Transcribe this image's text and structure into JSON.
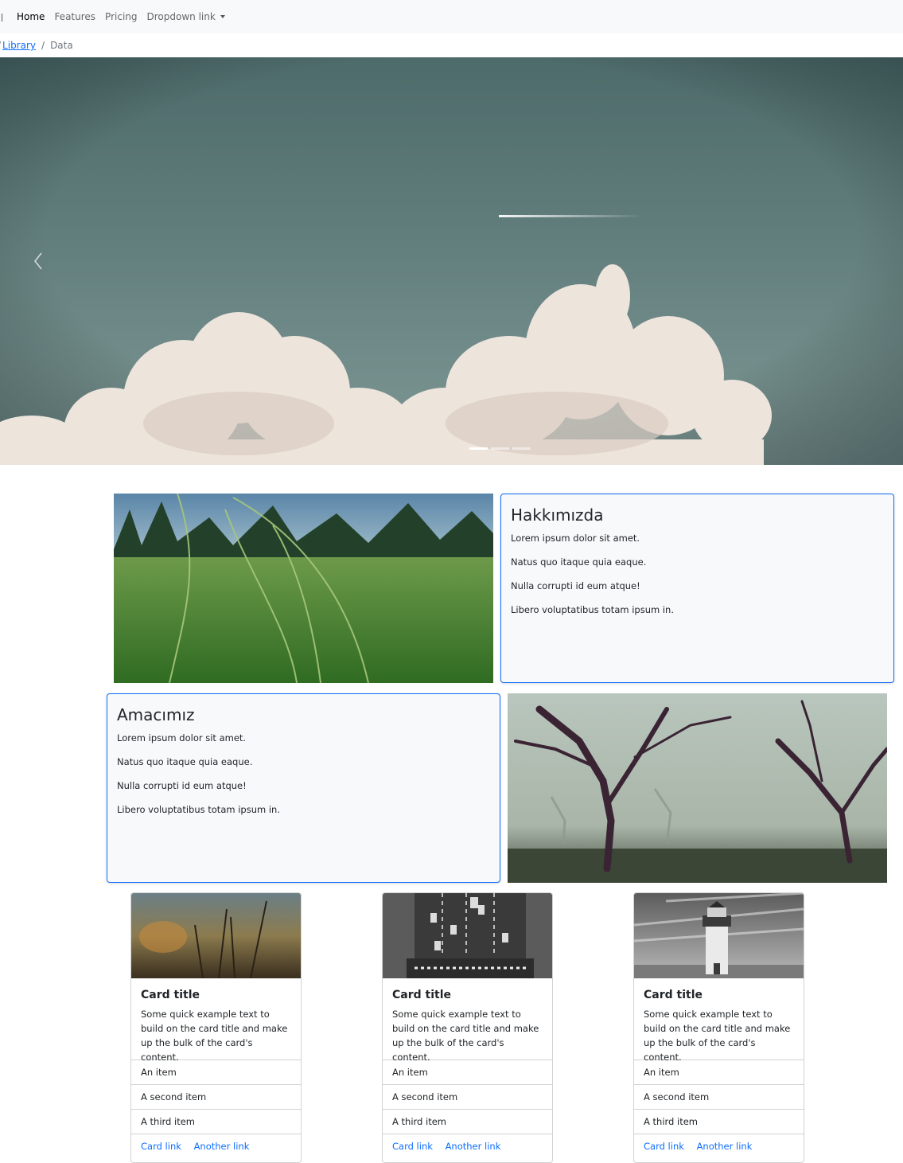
{
  "navbar": {
    "links": [
      {
        "label": "Home",
        "active": true
      },
      {
        "label": "Features",
        "active": false
      },
      {
        "label": "Pricing",
        "active": false
      },
      {
        "label": "Dropdown link",
        "active": false
      }
    ]
  },
  "breadcrumb": {
    "items": [
      "Library",
      "Data"
    ]
  },
  "carousel": {
    "slide_count": 3,
    "active_index": 0
  },
  "about": {
    "title": "Hakkımızda",
    "lines": [
      "Lorem ipsum dolor sit amet.",
      "Natus quo itaque quia eaque.",
      "Nulla corrupti id eum atque!",
      "Libero voluptatibus totam ipsum in."
    ]
  },
  "mission": {
    "title": "Amacımız",
    "lines": [
      "Lorem ipsum dolor sit amet.",
      "Natus quo itaque quia eaque.",
      "Nulla corrupti id eum atque!",
      "Libero voluptatibus totam ipsum in."
    ]
  },
  "cards": [
    {
      "title": "Card title",
      "text": "Some quick example text to build on the card title and make up the bulk of the card's content.",
      "items": [
        "An item",
        "A second item",
        "A third item"
      ],
      "links": [
        "Card link",
        "Another link"
      ]
    },
    {
      "title": "Card title",
      "text": "Some quick example text to build on the card title and make up the bulk of the card's content.",
      "items": [
        "An item",
        "A second item",
        "A third item"
      ],
      "links": [
        "Card link",
        "Another link"
      ]
    },
    {
      "title": "Card title",
      "text": "Some quick example text to build on the card title and make up the bulk of the card's content.",
      "items": [
        "An item",
        "A second item",
        "A third item"
      ],
      "links": [
        "Card link",
        "Another link"
      ]
    }
  ],
  "colors": {
    "primary": "#0d6efd",
    "navbar_bg": "#f8f9fa",
    "card_border": "#0d6efd"
  }
}
